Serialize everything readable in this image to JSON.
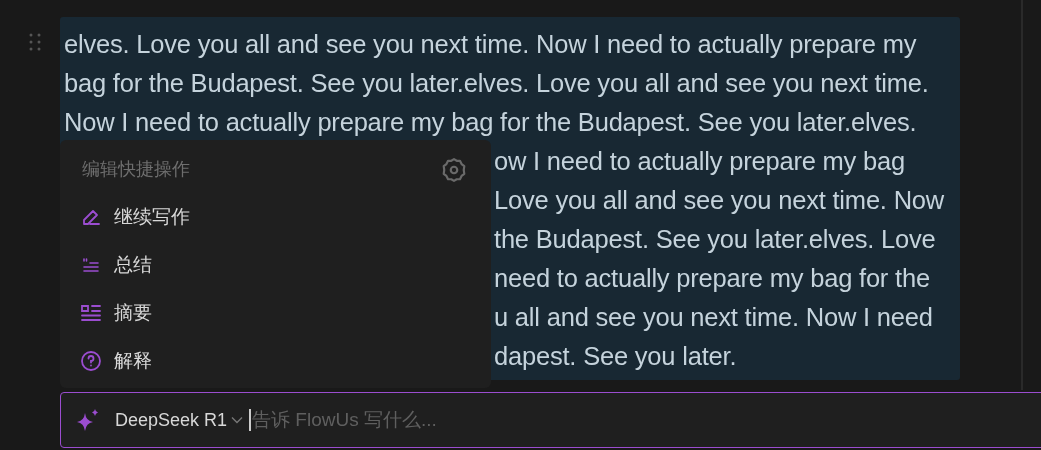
{
  "paragraph": {
    "lines_above_menu": [
      "elves. Love you all and see you next time. Now I need to actually prepare my",
      "bag for the Budapest. See you later.elves. Love you all and see you next time.",
      "Now I need to actually prepare my bag for the Budapest. See you later.elves."
    ],
    "lines_beside_menu": [
      "ow I need to actually prepare my bag",
      "Love you all and see you next time. Now",
      "the Budapest. See you later.elves. Love",
      "need to actually prepare my bag for the",
      "u all and see you next time. Now I need",
      "dapest. See you later."
    ]
  },
  "quick_menu": {
    "title": "编辑快捷操作",
    "items": [
      {
        "kind": "pencil",
        "label": "继续写作"
      },
      {
        "kind": "summary",
        "label": "总结"
      },
      {
        "kind": "abstract",
        "label": "摘要"
      },
      {
        "kind": "question",
        "label": "解释"
      }
    ]
  },
  "ai_input": {
    "model": "DeepSeek R1",
    "placeholder": "告诉 FlowUs 写什么..."
  }
}
